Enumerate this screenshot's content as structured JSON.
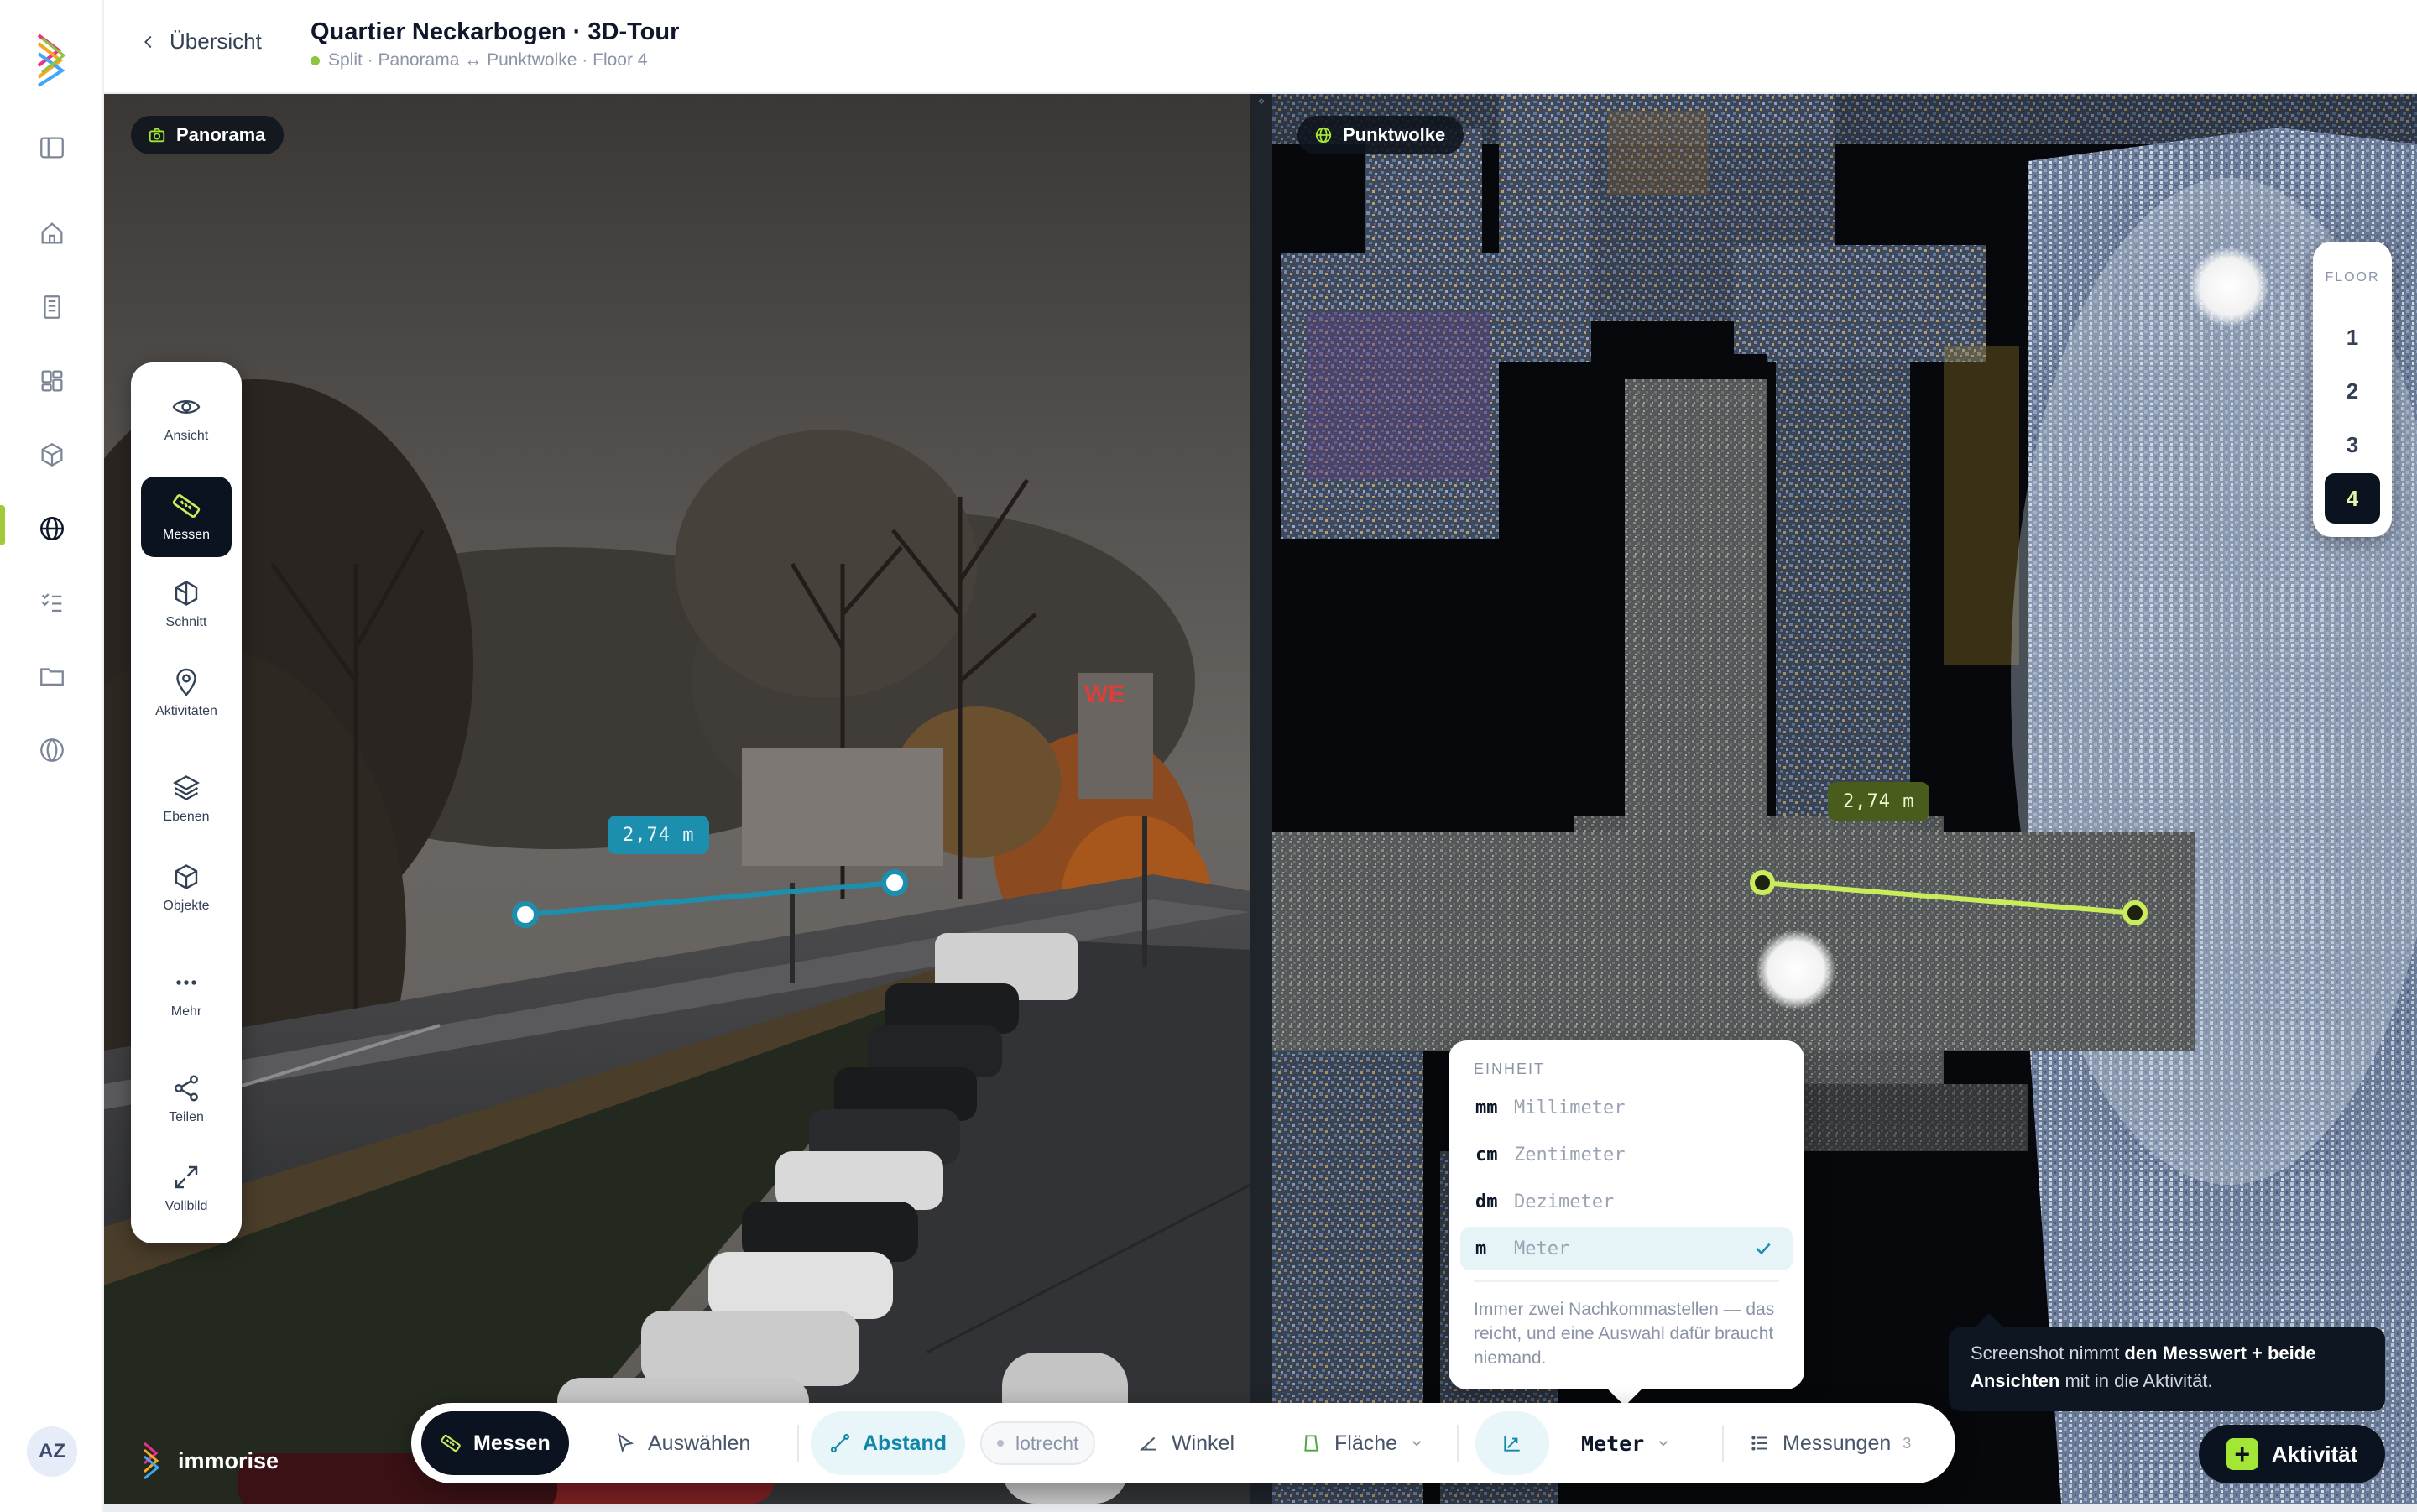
{
  "header": {
    "back_label": "Übersicht",
    "title": "Quartier Neckarbogen · 3D-Tour",
    "subtitle": "Split · Panorama ↔ Punktwolke · Floor 4"
  },
  "user": {
    "initials": "AZ"
  },
  "panes": {
    "left_badge": "Panorama",
    "right_badge": "Punktwolke"
  },
  "tools": [
    {
      "label": "Ansicht",
      "icon": "eye-icon"
    },
    {
      "label": "Messen",
      "icon": "ruler-icon",
      "active": true
    },
    {
      "label": "Schnitt",
      "icon": "section-cube-icon"
    },
    {
      "label": "Aktivitäten",
      "icon": "map-pin-icon"
    },
    {
      "label": "Ebenen",
      "icon": "layers-icon"
    },
    {
      "label": "Objekte",
      "icon": "box-icon"
    },
    {
      "label": "Mehr",
      "icon": "more-dots-icon"
    },
    {
      "label": "Teilen",
      "icon": "share-icon"
    },
    {
      "label": "Vollbild",
      "icon": "fullscreen-icon"
    }
  ],
  "measurement": {
    "pano_value": "2,74 m",
    "cloud_value": "2,74 m",
    "pano_color": "#1d8fae",
    "cloud_color": "#c8ec5a"
  },
  "floors": {
    "title": "FLOOR",
    "items": [
      "1",
      "2",
      "3",
      "4"
    ],
    "active": "4"
  },
  "unit_menu": {
    "heading": "EINHEIT",
    "options": [
      {
        "abbr": "mm",
        "name": "Millimeter"
      },
      {
        "abbr": "cm",
        "name": "Zentimeter"
      },
      {
        "abbr": "dm",
        "name": "Dezimeter"
      },
      {
        "abbr": "m",
        "name": "Meter",
        "selected": true
      }
    ],
    "note": "Immer zwei Nachkommastellen — das reicht, und eine Auswahl dafür braucht niemand."
  },
  "tooltip": {
    "pre": "Screenshot nimmt ",
    "bold1": "den Messwert + beide Ansichten",
    "post": " mit in die Aktivität."
  },
  "toolbar": {
    "measure": "Messen",
    "select": "Auswählen",
    "distance": "Abstand",
    "plumb": "lotrecht",
    "angle": "Winkel",
    "area": "Fläche",
    "unit": "Meter",
    "measurements": "Messungen",
    "measurements_count": "3"
  },
  "brand": {
    "name": "immorise"
  },
  "activity_button": {
    "label": "Aktivität"
  },
  "colors": {
    "accent_dark": "#0b1220",
    "accent_lime": "#a3e635",
    "accent_teal": "#1d8fae"
  }
}
